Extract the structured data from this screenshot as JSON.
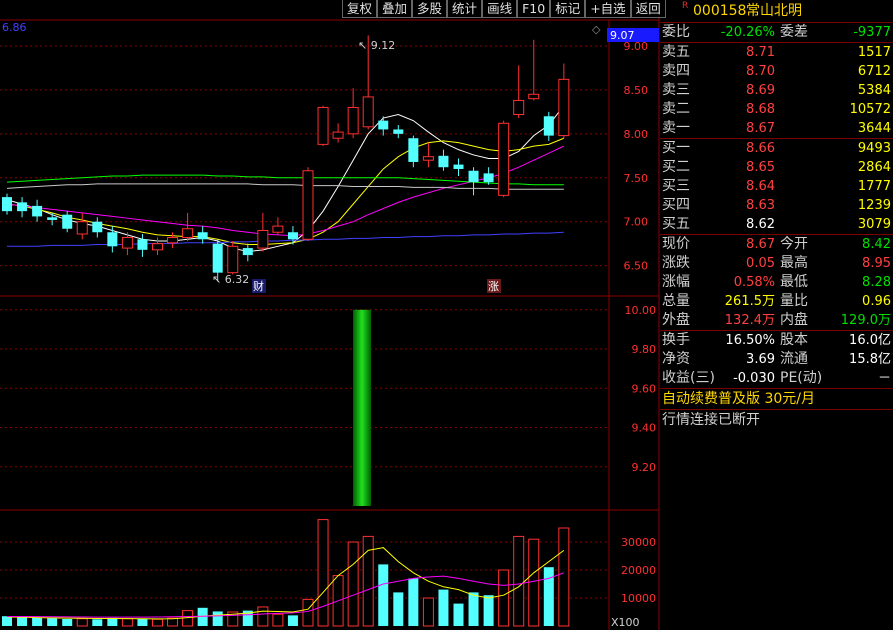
{
  "toolbar": [
    "复权",
    "叠加",
    "多股",
    "统计",
    "画线",
    "F10",
    "标记",
    "+自选",
    "返回"
  ],
  "chart_labels": {
    "corner_value": "6.86",
    "current_price_tag": "9.07",
    "max_label": "9.12",
    "min_label": "6.32",
    "event_cai": "财",
    "event_zhang": "涨",
    "volume_unit": "X100"
  },
  "chart_data": [
    {
      "type": "candlestick",
      "price_axis": [
        9.0,
        8.5,
        8.0,
        7.5,
        7.0,
        6.5
      ],
      "ylim": [
        6.2,
        9.25
      ],
      "candles": [
        {
          "o": 7.28,
          "c": 7.12,
          "h": 7.32,
          "l": 7.08
        },
        {
          "o": 7.22,
          "c": 7.12,
          "h": 7.28,
          "l": 7.05
        },
        {
          "o": 7.18,
          "c": 7.06,
          "h": 7.25,
          "l": 7.0
        },
        {
          "o": 7.05,
          "c": 7.02,
          "h": 7.1,
          "l": 6.96
        },
        {
          "o": 7.08,
          "c": 6.92,
          "h": 7.12,
          "l": 6.88
        },
        {
          "o": 6.86,
          "c": 7.0,
          "h": 7.1,
          "l": 6.8
        },
        {
          "o": 7.0,
          "c": 6.88,
          "h": 7.05,
          "l": 6.82
        },
        {
          "o": 6.88,
          "c": 6.72,
          "h": 6.95,
          "l": 6.65
        },
        {
          "o": 6.7,
          "c": 6.82,
          "h": 6.88,
          "l": 6.62
        },
        {
          "o": 6.8,
          "c": 6.68,
          "h": 6.86,
          "l": 6.6
        },
        {
          "o": 6.68,
          "c": 6.75,
          "h": 6.82,
          "l": 6.62
        },
        {
          "o": 6.76,
          "c": 6.82,
          "h": 6.88,
          "l": 6.7
        },
        {
          "o": 6.82,
          "c": 6.92,
          "h": 7.1,
          "l": 6.78
        },
        {
          "o": 6.88,
          "c": 6.8,
          "h": 6.95,
          "l": 6.75
        },
        {
          "o": 6.75,
          "c": 6.42,
          "h": 6.8,
          "l": 6.32
        },
        {
          "o": 6.42,
          "c": 6.72,
          "h": 6.78,
          "l": 6.4
        },
        {
          "o": 6.7,
          "c": 6.62,
          "h": 6.75,
          "l": 6.55
        },
        {
          "o": 6.7,
          "c": 6.9,
          "h": 7.1,
          "l": 6.66
        },
        {
          "o": 6.88,
          "c": 6.95,
          "h": 7.05,
          "l": 6.85
        },
        {
          "o": 6.88,
          "c": 6.8,
          "h": 6.95,
          "l": 6.74
        },
        {
          "o": 6.8,
          "c": 7.58,
          "h": 7.62,
          "l": 6.78
        },
        {
          "o": 7.88,
          "c": 8.3,
          "h": 8.32,
          "l": 7.86
        },
        {
          "o": 7.95,
          "c": 8.02,
          "h": 8.12,
          "l": 7.9
        },
        {
          "o": 8.0,
          "c": 8.3,
          "h": 8.52,
          "l": 7.95
        },
        {
          "o": 8.08,
          "c": 8.42,
          "h": 9.12,
          "l": 8.05
        },
        {
          "o": 8.15,
          "c": 8.05,
          "h": 8.2,
          "l": 7.98
        },
        {
          "o": 8.05,
          "c": 8.0,
          "h": 8.1,
          "l": 7.95
        },
        {
          "o": 7.95,
          "c": 7.68,
          "h": 7.98,
          "l": 7.62
        },
        {
          "o": 7.7,
          "c": 7.74,
          "h": 7.9,
          "l": 7.62
        },
        {
          "o": 7.75,
          "c": 7.62,
          "h": 7.82,
          "l": 7.58
        },
        {
          "o": 7.65,
          "c": 7.6,
          "h": 7.72,
          "l": 7.52
        },
        {
          "o": 7.58,
          "c": 7.45,
          "h": 7.62,
          "l": 7.3
        },
        {
          "o": 7.55,
          "c": 7.45,
          "h": 7.62,
          "l": 7.42
        },
        {
          "o": 7.3,
          "c": 8.12,
          "h": 8.15,
          "l": 7.28
        },
        {
          "o": 8.22,
          "c": 8.38,
          "h": 8.78,
          "l": 8.18
        },
        {
          "o": 8.4,
          "c": 8.45,
          "h": 9.07,
          "l": 8.38
        },
        {
          "o": 8.2,
          "c": 7.98,
          "h": 8.25,
          "l": 7.92
        },
        {
          "o": 7.98,
          "c": 8.62,
          "h": 8.8,
          "l": 7.95
        }
      ],
      "ma_lines": [
        {
          "color": "#ffffff",
          "values": [
            7.25,
            7.2,
            7.15,
            7.08,
            7.02,
            6.98,
            6.95,
            6.9,
            6.85,
            6.8,
            6.78,
            6.78,
            6.8,
            6.82,
            6.78,
            6.7,
            6.66,
            6.68,
            6.72,
            6.76,
            6.9,
            7.12,
            7.4,
            7.7,
            8.0,
            8.18,
            8.22,
            8.15,
            8.02,
            7.9,
            7.82,
            7.76,
            7.72,
            7.72,
            7.8,
            7.98,
            8.1,
            8.32
          ]
        },
        {
          "color": "#ffff00",
          "values": [
            7.2,
            7.18,
            7.14,
            7.1,
            7.05,
            7.02,
            6.98,
            6.95,
            6.92,
            6.88,
            6.85,
            6.84,
            6.83,
            6.83,
            6.8,
            6.76,
            6.74,
            6.74,
            6.75,
            6.76,
            6.8,
            6.88,
            7.0,
            7.2,
            7.4,
            7.6,
            7.74,
            7.84,
            7.9,
            7.92,
            7.9,
            7.86,
            7.82,
            7.8,
            7.82,
            7.86,
            7.88,
            7.95
          ]
        },
        {
          "color": "#ff00ff",
          "values": [
            7.2,
            7.18,
            7.16,
            7.14,
            7.12,
            7.1,
            7.08,
            7.06,
            7.04,
            7.02,
            7.0,
            6.98,
            6.96,
            6.95,
            6.93,
            6.9,
            6.88,
            6.86,
            6.85,
            6.84,
            6.86,
            6.9,
            6.95,
            7.0,
            7.08,
            7.15,
            7.22,
            7.28,
            7.33,
            7.38,
            7.42,
            7.46,
            7.5,
            7.55,
            7.62,
            7.7,
            7.78,
            7.86
          ]
        },
        {
          "color": "#00ff00",
          "values": [
            7.45,
            7.46,
            7.47,
            7.48,
            7.49,
            7.5,
            7.51,
            7.52,
            7.52,
            7.53,
            7.53,
            7.53,
            7.53,
            7.53,
            7.52,
            7.52,
            7.51,
            7.51,
            7.5,
            7.5,
            7.5,
            7.5,
            7.5,
            7.5,
            7.5,
            7.5,
            7.5,
            7.49,
            7.48,
            7.47,
            7.46,
            7.45,
            7.44,
            7.43,
            7.43,
            7.42,
            7.42,
            7.42
          ]
        },
        {
          "color": "#4040ff",
          "values": [
            6.72,
            6.72,
            6.72,
            6.73,
            6.73,
            6.73,
            6.74,
            6.74,
            6.74,
            6.75,
            6.75,
            6.75,
            6.76,
            6.76,
            6.76,
            6.77,
            6.77,
            6.78,
            6.78,
            6.79,
            6.79,
            6.8,
            6.8,
            6.81,
            6.81,
            6.82,
            6.82,
            6.83,
            6.83,
            6.84,
            6.84,
            6.85,
            6.85,
            6.86,
            6.86,
            6.87,
            6.87,
            6.88
          ]
        },
        {
          "color": "#c8c8c8",
          "values": [
            7.38,
            7.39,
            7.4,
            7.41,
            7.42,
            7.42,
            7.43,
            7.43,
            7.43,
            7.43,
            7.43,
            7.43,
            7.43,
            7.43,
            7.43,
            7.43,
            7.43,
            7.42,
            7.42,
            7.42,
            7.41,
            7.41,
            7.41,
            7.4,
            7.4,
            7.4,
            7.4,
            7.39,
            7.39,
            7.39,
            7.38,
            7.38,
            7.38,
            7.37,
            7.37,
            7.37,
            7.37,
            7.37
          ]
        }
      ]
    },
    {
      "type": "bar",
      "yaxis": [
        10.0,
        9.8,
        9.6,
        9.4,
        9.2
      ],
      "ylim": [
        9.0,
        10.05
      ],
      "bar": {
        "from": 9.0,
        "to": 10.0
      }
    },
    {
      "type": "bar",
      "yaxis": [
        30000,
        20000,
        10000
      ],
      "ylim": [
        0,
        40000
      ],
      "volumes": [
        3500,
        3200,
        3000,
        2800,
        2500,
        2600,
        2400,
        2900,
        2600,
        2500,
        2400,
        2800,
        5500,
        6500,
        5200,
        5000,
        5500,
        6800,
        4200,
        3800,
        9500,
        38000,
        18000,
        30000,
        32000,
        22000,
        12000,
        17000,
        10000,
        13000,
        8000,
        12000,
        11000,
        20000,
        32000,
        31000,
        21000,
        35000
      ],
      "ma_lines": [
        {
          "color": "#ffff00",
          "values": [
            3200,
            3150,
            3000,
            2900,
            2800,
            2750,
            2700,
            2700,
            2650,
            2600,
            2550,
            2600,
            3000,
            3500,
            3900,
            4200,
            4600,
            5300,
            5200,
            5000,
            6000,
            12000,
            18000,
            22000,
            27000,
            28000,
            23000,
            19000,
            16000,
            14000,
            13000,
            11000,
            10000,
            11000,
            14000,
            19000,
            23000,
            27000
          ]
        },
        {
          "color": "#ff00ff",
          "values": [
            3400,
            3380,
            3350,
            3300,
            3250,
            3200,
            3150,
            3150,
            3150,
            3150,
            3200,
            3300,
            3400,
            3500,
            3600,
            3800,
            4000,
            4300,
            4500,
            4700,
            5200,
            7000,
            9000,
            11000,
            13000,
            15000,
            16000,
            17000,
            17500,
            17800,
            17000,
            16000,
            15000,
            14500,
            15000,
            16000,
            17000,
            19000
          ]
        }
      ]
    }
  ],
  "quote": {
    "rmark": "R",
    "code": "000158",
    "name": "常山北明",
    "weibi_label": "委比",
    "weibi": "-20.26%",
    "weicha_label": "委差",
    "weicha": "-9377",
    "asks": [
      {
        "label": "卖五",
        "price": "8.71",
        "vol": "1517"
      },
      {
        "label": "卖四",
        "price": "8.70",
        "vol": "6712"
      },
      {
        "label": "卖三",
        "price": "8.69",
        "vol": "5384"
      },
      {
        "label": "卖二",
        "price": "8.68",
        "vol": "10572"
      },
      {
        "label": "卖一",
        "price": "8.67",
        "vol": "3644"
      }
    ],
    "bids": [
      {
        "label": "买一",
        "price": "8.66",
        "vol": "9493"
      },
      {
        "label": "买二",
        "price": "8.65",
        "vol": "2864"
      },
      {
        "label": "买三",
        "price": "8.64",
        "vol": "1777"
      },
      {
        "label": "买四",
        "price": "8.63",
        "vol": "1239"
      },
      {
        "label": "买五",
        "price": "8.62",
        "vol": "3079"
      }
    ],
    "stats": [
      [
        {
          "l": "现价",
          "v": "8.67"
        },
        {
          "l": "今开",
          "v": "8.42"
        }
      ],
      [
        {
          "l": "涨跌",
          "v": "0.05"
        },
        {
          "l": "最高",
          "v": "8.95"
        }
      ],
      [
        {
          "l": "涨幅",
          "v": "0.58%"
        },
        {
          "l": "最低",
          "v": "8.28"
        }
      ],
      [
        {
          "l": "总量",
          "v": "261.5万"
        },
        {
          "l": "量比",
          "v": "0.96"
        }
      ],
      [
        {
          "l": "外盘",
          "v": "132.4万"
        },
        {
          "l": "内盘",
          "v": "129.0万"
        }
      ]
    ],
    "fund": [
      [
        {
          "l": "换手",
          "v": "16.50%"
        },
        {
          "l": "股本",
          "v": "16.0亿"
        }
      ],
      [
        {
          "l": "净资",
          "v": "3.69"
        },
        {
          "l": "流通",
          "v": "15.8亿"
        }
      ],
      [
        {
          "l": "收益(三)",
          "v": "-0.030"
        },
        {
          "l": "PE(动)",
          "v": "－"
        }
      ]
    ],
    "ad": "自动续费普及版  30元/月",
    "status": "行情连接已断开"
  }
}
